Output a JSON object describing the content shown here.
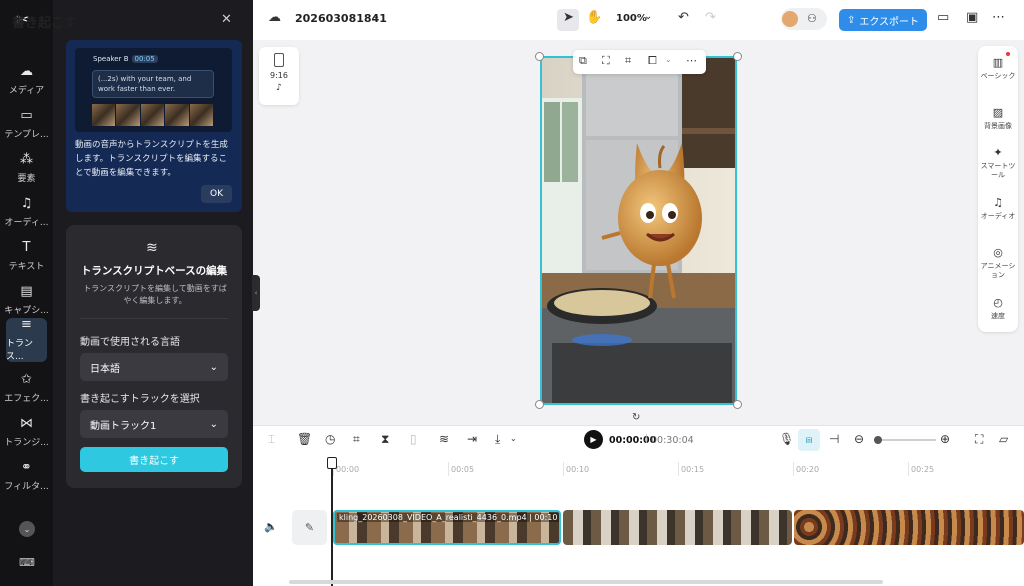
{
  "rail": {
    "items": [
      {
        "label": "メディア",
        "icon": "cloud-upload-icon"
      },
      {
        "label": "テンプレ...",
        "icon": "template-icon"
      },
      {
        "label": "要素",
        "icon": "elements-icon"
      },
      {
        "label": "オーディ...",
        "icon": "music-note-icon"
      },
      {
        "label": "テキスト",
        "icon": "text-icon"
      },
      {
        "label": "キャプシ...",
        "icon": "captions-icon"
      },
      {
        "label": "トランス...",
        "icon": "transcript-icon"
      },
      {
        "label": "エフェク...",
        "icon": "effects-icon"
      },
      {
        "label": "トランジ...",
        "icon": "transition-icon"
      },
      {
        "label": "フィルタ...",
        "icon": "filter-icon"
      }
    ]
  },
  "panel": {
    "title": "書き起こす",
    "tip": {
      "speaker": "Speaker B",
      "speaker_time": "00:05",
      "bubble": "(...2s) with your team, and work faster than ever.",
      "text": "動画の音声からトランスクリプトを生成します。トランスクリプトを編集することで動画を編集できます。",
      "ok": "OK"
    },
    "card": {
      "title": "トランスクリプトベースの編集",
      "desc": "トランスクリプトを編集して動画をすばやく編集します。",
      "language_label": "動画で使用される言語",
      "language_value": "日本語",
      "track_label": "書き起こすトラックを選択",
      "track_value": "動画トラック1",
      "submit": "書き起こす"
    }
  },
  "topbar": {
    "project": "202603081841",
    "zoom": "100%",
    "export": "エクスポート"
  },
  "ratio": {
    "label": "9:16"
  },
  "right_tools": [
    {
      "label": "ベーシック",
      "icon": "basic-icon"
    },
    {
      "label": "背景画像",
      "icon": "background-icon"
    },
    {
      "label": "スマートツール",
      "icon": "smart-tool-icon"
    },
    {
      "label": "オーディオ",
      "icon": "audio-icon"
    },
    {
      "label": "アニメーション",
      "icon": "animation-icon"
    },
    {
      "label": "速度",
      "icon": "speed-icon"
    }
  ],
  "timeline": {
    "current": "00:00:00",
    "total": "00:30:04",
    "ruler": [
      "00:00",
      "00:05",
      "00:10",
      "00:15",
      "00:20",
      "00:25"
    ],
    "clip_name": "kling_20260308_VIDEO_A_realisti_4436_0.mp4",
    "clip_duration": "00:10"
  },
  "colors": {
    "accent": "#2ec8e0",
    "export": "#2e8de8",
    "selection": "#31c2d6"
  }
}
